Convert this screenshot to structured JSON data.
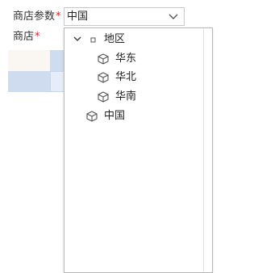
{
  "form": {
    "store_param_label": "商店参数",
    "store_param_value": "中国",
    "store_label": "商店",
    "required_mark": "*"
  },
  "tree": {
    "root": {
      "label": "地区",
      "expanded": true,
      "icon": "square-bullet-icon"
    },
    "children": [
      {
        "label": "华东",
        "icon": "cube-icon"
      },
      {
        "label": "华北",
        "icon": "cube-icon"
      },
      {
        "label": "华南",
        "icon": "cube-icon"
      }
    ],
    "sibling": {
      "label": "中国",
      "icon": "cube-icon"
    }
  },
  "colors": {
    "accent_blue": "#cfdcf0",
    "light_blue": "#e6edf8",
    "beige": "#faf7f2",
    "required": "#e02020",
    "border": "#c8c8c8"
  }
}
